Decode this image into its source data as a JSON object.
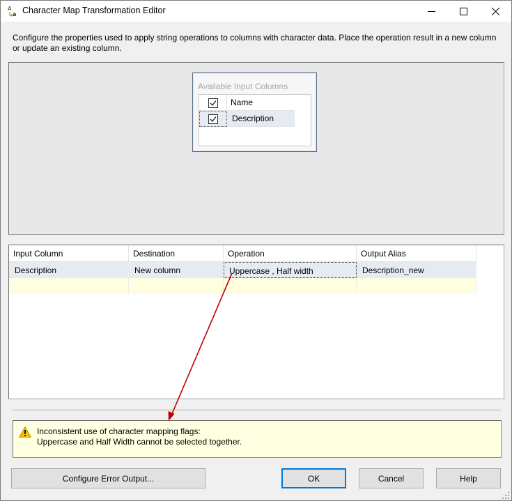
{
  "window": {
    "title": "Character Map Transformation Editor",
    "icon": "character-map-icon",
    "controls": [
      "minimize-icon",
      "maximize-icon",
      "close-icon"
    ]
  },
  "description": "Configure the properties used to apply string operations to columns with character data. Place the operation result in a new column or update an existing column.",
  "available_columns": {
    "title": "Available Input Columns",
    "items": [
      {
        "label": "Name",
        "checked": true
      },
      {
        "label": "Description",
        "checked": true
      }
    ]
  },
  "grid": {
    "headers": [
      "Input Column",
      "Destination",
      "Operation",
      "Output Alias"
    ],
    "rows": [
      {
        "input_column": "Description",
        "destination": "New column",
        "operation": "Uppercase , Half width",
        "output_alias": "Description_new"
      }
    ]
  },
  "warning": {
    "icon": "warning-icon",
    "line1": "Inconsistent use of character mapping flags:",
    "line2": "Uppercase and Half Width cannot be selected together."
  },
  "buttons": {
    "configure_error_output": "Configure Error Output...",
    "ok": "OK",
    "cancel": "Cancel",
    "help": "Help"
  },
  "colors": {
    "annotation_arrow": "#c00000",
    "selected_row": "#e6ebf2",
    "new_row": "#fffee0",
    "warning_background": "#ffffe1",
    "default_button_border": "#0078d7"
  }
}
